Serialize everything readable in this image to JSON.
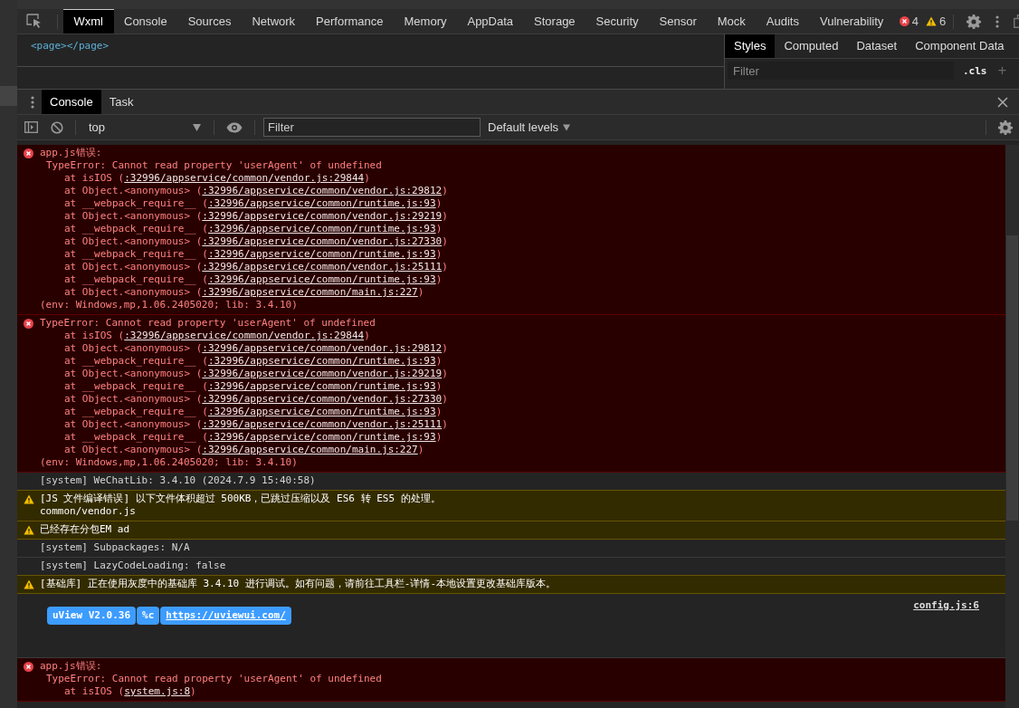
{
  "devtools_tabs": [
    {
      "label": "Wxml",
      "selected": true
    },
    {
      "label": "Console",
      "selected": false
    },
    {
      "label": "Sources",
      "selected": false
    },
    {
      "label": "Network",
      "selected": false
    },
    {
      "label": "Performance",
      "selected": false
    },
    {
      "label": "Memory",
      "selected": false
    },
    {
      "label": "AppData",
      "selected": false
    },
    {
      "label": "Storage",
      "selected": false
    },
    {
      "label": "Security",
      "selected": false
    },
    {
      "label": "Sensor",
      "selected": false
    },
    {
      "label": "Mock",
      "selected": false
    },
    {
      "label": "Audits",
      "selected": false
    },
    {
      "label": "Vulnerability",
      "selected": false
    }
  ],
  "issue_counts": {
    "errors": "4",
    "warnings": "6"
  },
  "wxml": {
    "content": "<page></page>"
  },
  "styles_pane": {
    "tabs": [
      {
        "label": "Styles",
        "selected": true
      },
      {
        "label": "Computed",
        "selected": false
      },
      {
        "label": "Dataset",
        "selected": false
      },
      {
        "label": "Component Data",
        "selected": false
      }
    ],
    "filter": {
      "placeholder": "Filter"
    },
    "cls_button": ".cls",
    "add_button": "+"
  },
  "drawer_tabs": [
    {
      "label": "Console",
      "selected": true
    },
    {
      "label": "Task",
      "selected": false
    }
  ],
  "console_toolbar": {
    "context": "top",
    "filter": {
      "placeholder": "Filter"
    },
    "levels": "Default levels"
  },
  "messages": [
    {
      "kind": "error",
      "lines": [
        {
          "kind": "head",
          "text": "app.js错误:"
        },
        {
          "kind": "detail",
          "text": "TypeError: Cannot read property 'userAgent' of undefined"
        },
        {
          "kind": "frame",
          "text": "at isIOS (",
          "link": ":32996/appservice/common/vendor.js:29844",
          "tail": ")"
        },
        {
          "kind": "frame",
          "text": "at Object.<anonymous> (",
          "link": ":32996/appservice/common/vendor.js:29812",
          "tail": ")"
        },
        {
          "kind": "frame",
          "text": "at __webpack_require__ (",
          "link": ":32996/appservice/common/runtime.js:93",
          "tail": ")"
        },
        {
          "kind": "frame",
          "text": "at Object.<anonymous> (",
          "link": ":32996/appservice/common/vendor.js:29219",
          "tail": ")"
        },
        {
          "kind": "frame",
          "text": "at __webpack_require__ (",
          "link": ":32996/appservice/common/runtime.js:93",
          "tail": ")"
        },
        {
          "kind": "frame",
          "text": "at Object.<anonymous> (",
          "link": ":32996/appservice/common/vendor.js:27330",
          "tail": ")"
        },
        {
          "kind": "frame",
          "text": "at __webpack_require__ (",
          "link": ":32996/appservice/common/runtime.js:93",
          "tail": ")"
        },
        {
          "kind": "frame",
          "text": "at Object.<anonymous> (",
          "link": ":32996/appservice/common/vendor.js:25111",
          "tail": ")"
        },
        {
          "kind": "frame",
          "text": "at __webpack_require__ (",
          "link": ":32996/appservice/common/runtime.js:93",
          "tail": ")"
        },
        {
          "kind": "frame",
          "text": "at Object.<anonymous> (",
          "link": ":32996/appservice/common/main.js:227",
          "tail": ")"
        },
        {
          "kind": "head",
          "text": "(env: Windows,mp,1.06.2405020; lib: 3.4.10)"
        }
      ]
    },
    {
      "kind": "error",
      "lines": [
        {
          "kind": "head",
          "text": "TypeError: Cannot read property 'userAgent' of undefined"
        },
        {
          "kind": "frame",
          "text": "at isIOS (",
          "link": ":32996/appservice/common/vendor.js:29844",
          "tail": ")"
        },
        {
          "kind": "frame",
          "text": "at Object.<anonymous> (",
          "link": ":32996/appservice/common/vendor.js:29812",
          "tail": ")"
        },
        {
          "kind": "frame",
          "text": "at __webpack_require__ (",
          "link": ":32996/appservice/common/runtime.js:93",
          "tail": ")"
        },
        {
          "kind": "frame",
          "text": "at Object.<anonymous> (",
          "link": ":32996/appservice/common/vendor.js:29219",
          "tail": ")"
        },
        {
          "kind": "frame",
          "text": "at __webpack_require__ (",
          "link": ":32996/appservice/common/runtime.js:93",
          "tail": ")"
        },
        {
          "kind": "frame",
          "text": "at Object.<anonymous> (",
          "link": ":32996/appservice/common/vendor.js:27330",
          "tail": ")"
        },
        {
          "kind": "frame",
          "text": "at __webpack_require__ (",
          "link": ":32996/appservice/common/runtime.js:93",
          "tail": ")"
        },
        {
          "kind": "frame",
          "text": "at Object.<anonymous> (",
          "link": ":32996/appservice/common/vendor.js:25111",
          "tail": ")"
        },
        {
          "kind": "frame",
          "text": "at __webpack_require__ (",
          "link": ":32996/appservice/common/runtime.js:93",
          "tail": ")"
        },
        {
          "kind": "frame",
          "text": "at Object.<anonymous> (",
          "link": ":32996/appservice/common/main.js:227",
          "tail": ")"
        },
        {
          "kind": "head",
          "text": "(env: Windows,mp,1.06.2405020; lib: 3.4.10)"
        }
      ]
    },
    {
      "kind": "info",
      "lines": [
        {
          "kind": "head",
          "text": "[system] WeChatLib: 3.4.10 (2024.7.9 15:40:58)"
        }
      ]
    },
    {
      "kind": "warning",
      "lines": [
        {
          "kind": "head",
          "text": "[JS 文件编译错误] 以下文件体积超过 500KB，已跳过压缩以及 ES6 转 ES5 的处理。"
        },
        {
          "kind": "head",
          "text": "common/vendor.js"
        }
      ]
    },
    {
      "kind": "warning",
      "lines": [
        {
          "kind": "head",
          "text": "已经存在分包EM ad"
        }
      ]
    },
    {
      "kind": "info",
      "lines": [
        {
          "kind": "head",
          "text": "[system] Subpackages: N/A"
        }
      ]
    },
    {
      "kind": "info",
      "lines": [
        {
          "kind": "head",
          "text": "[system] LazyCodeLoading: false"
        }
      ]
    },
    {
      "kind": "warning",
      "lines": [
        {
          "kind": "head",
          "text": "[基础库] 正在使用灰度中的基础库 3.4.10 进行调试。如有问题，请前往工具栏-详情-本地设置更改基础库版本。"
        }
      ]
    },
    {
      "kind": "info",
      "badges": [
        {
          "kind": "label",
          "text": "uView V2.0.36"
        },
        {
          "kind": "label",
          "text": "%c"
        },
        {
          "kind": "link",
          "text": "https://uviewui.com/"
        }
      ],
      "source": "config.js:6"
    },
    {
      "kind": "error",
      "lines": [
        {
          "kind": "head",
          "text": "app.js错误:"
        },
        {
          "kind": "detail",
          "text": "TypeError: Cannot read property 'userAgent' of undefined"
        },
        {
          "kind": "frame",
          "text": "at isIOS (",
          "link": "system.js:8",
          "tail": ")"
        }
      ]
    }
  ]
}
